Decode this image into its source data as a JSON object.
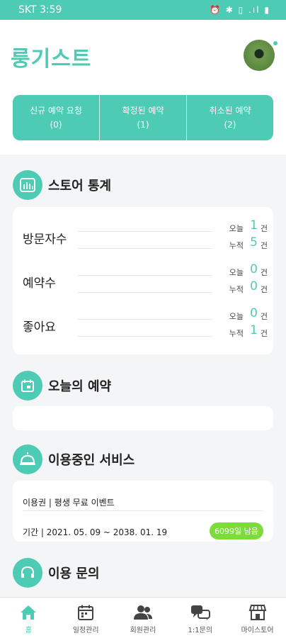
{
  "status_bar": {
    "carrier_time": "SKT 3:59",
    "icons": "⏰ ✱ ▯ .ıl ▮"
  },
  "header": {
    "title": "룽기스트"
  },
  "reservations": [
    {
      "label": "신규 예약 요청",
      "count": "(0)"
    },
    {
      "label": "확정된 예약",
      "count": "(1)"
    },
    {
      "label": "취소된 예약",
      "count": "(2)"
    }
  ],
  "stats": {
    "title": "스토어 통계",
    "rows": [
      {
        "label": "방문자수",
        "today_label": "오늘",
        "today": "1",
        "total_label": "누적",
        "total": "5",
        "unit": "건"
      },
      {
        "label": "예약수",
        "today_label": "오늘",
        "today": "0",
        "total_label": "누적",
        "total": "0",
        "unit": "건"
      },
      {
        "label": "좋아요",
        "today_label": "오늘",
        "today": "0",
        "total_label": "누적",
        "total": "1",
        "unit": "건"
      }
    ]
  },
  "today_reservations": {
    "title": "오늘의 예약"
  },
  "service": {
    "title": "이용중인 서비스",
    "plan": "이용권 | 평생 무료 이벤트",
    "period": "기간 | 2021. 05. 09 ~ 2038. 01. 19",
    "badge": "6099일 남음"
  },
  "inquiry": {
    "title": "이용 문의"
  },
  "nav": [
    {
      "label": "홈"
    },
    {
      "label": "일정관리"
    },
    {
      "label": "회원관리"
    },
    {
      "label": "1:1문의"
    },
    {
      "label": "마이스토어"
    }
  ],
  "colors": {
    "accent": "#4ecbb5",
    "badge": "#7bdc3a"
  }
}
